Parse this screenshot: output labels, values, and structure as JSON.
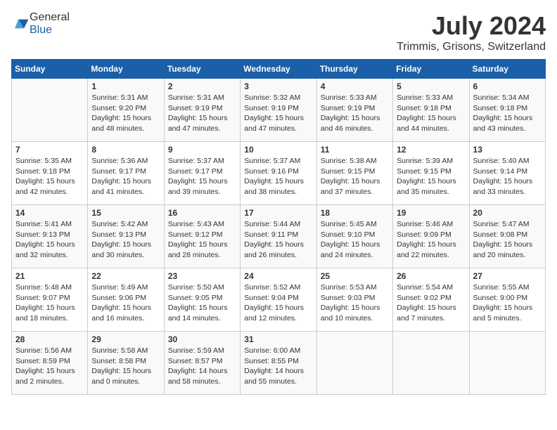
{
  "header": {
    "logo_general": "General",
    "logo_blue": "Blue",
    "month": "July 2024",
    "location": "Trimmis, Grisons, Switzerland"
  },
  "columns": [
    "Sunday",
    "Monday",
    "Tuesday",
    "Wednesday",
    "Thursday",
    "Friday",
    "Saturday"
  ],
  "weeks": [
    [
      {
        "day": "",
        "content": ""
      },
      {
        "day": "1",
        "content": "Sunrise: 5:31 AM\nSunset: 9:20 PM\nDaylight: 15 hours\nand 48 minutes."
      },
      {
        "day": "2",
        "content": "Sunrise: 5:31 AM\nSunset: 9:19 PM\nDaylight: 15 hours\nand 47 minutes."
      },
      {
        "day": "3",
        "content": "Sunrise: 5:32 AM\nSunset: 9:19 PM\nDaylight: 15 hours\nand 47 minutes."
      },
      {
        "day": "4",
        "content": "Sunrise: 5:33 AM\nSunset: 9:19 PM\nDaylight: 15 hours\nand 46 minutes."
      },
      {
        "day": "5",
        "content": "Sunrise: 5:33 AM\nSunset: 9:18 PM\nDaylight: 15 hours\nand 44 minutes."
      },
      {
        "day": "6",
        "content": "Sunrise: 5:34 AM\nSunset: 9:18 PM\nDaylight: 15 hours\nand 43 minutes."
      }
    ],
    [
      {
        "day": "7",
        "content": "Sunrise: 5:35 AM\nSunset: 9:18 PM\nDaylight: 15 hours\nand 42 minutes."
      },
      {
        "day": "8",
        "content": "Sunrise: 5:36 AM\nSunset: 9:17 PM\nDaylight: 15 hours\nand 41 minutes."
      },
      {
        "day": "9",
        "content": "Sunrise: 5:37 AM\nSunset: 9:17 PM\nDaylight: 15 hours\nand 39 minutes."
      },
      {
        "day": "10",
        "content": "Sunrise: 5:37 AM\nSunset: 9:16 PM\nDaylight: 15 hours\nand 38 minutes."
      },
      {
        "day": "11",
        "content": "Sunrise: 5:38 AM\nSunset: 9:15 PM\nDaylight: 15 hours\nand 37 minutes."
      },
      {
        "day": "12",
        "content": "Sunrise: 5:39 AM\nSunset: 9:15 PM\nDaylight: 15 hours\nand 35 minutes."
      },
      {
        "day": "13",
        "content": "Sunrise: 5:40 AM\nSunset: 9:14 PM\nDaylight: 15 hours\nand 33 minutes."
      }
    ],
    [
      {
        "day": "14",
        "content": "Sunrise: 5:41 AM\nSunset: 9:13 PM\nDaylight: 15 hours\nand 32 minutes."
      },
      {
        "day": "15",
        "content": "Sunrise: 5:42 AM\nSunset: 9:13 PM\nDaylight: 15 hours\nand 30 minutes."
      },
      {
        "day": "16",
        "content": "Sunrise: 5:43 AM\nSunset: 9:12 PM\nDaylight: 15 hours\nand 28 minutes."
      },
      {
        "day": "17",
        "content": "Sunrise: 5:44 AM\nSunset: 9:11 PM\nDaylight: 15 hours\nand 26 minutes."
      },
      {
        "day": "18",
        "content": "Sunrise: 5:45 AM\nSunset: 9:10 PM\nDaylight: 15 hours\nand 24 minutes."
      },
      {
        "day": "19",
        "content": "Sunrise: 5:46 AM\nSunset: 9:09 PM\nDaylight: 15 hours\nand 22 minutes."
      },
      {
        "day": "20",
        "content": "Sunrise: 5:47 AM\nSunset: 9:08 PM\nDaylight: 15 hours\nand 20 minutes."
      }
    ],
    [
      {
        "day": "21",
        "content": "Sunrise: 5:48 AM\nSunset: 9:07 PM\nDaylight: 15 hours\nand 18 minutes."
      },
      {
        "day": "22",
        "content": "Sunrise: 5:49 AM\nSunset: 9:06 PM\nDaylight: 15 hours\nand 16 minutes."
      },
      {
        "day": "23",
        "content": "Sunrise: 5:50 AM\nSunset: 9:05 PM\nDaylight: 15 hours\nand 14 minutes."
      },
      {
        "day": "24",
        "content": "Sunrise: 5:52 AM\nSunset: 9:04 PM\nDaylight: 15 hours\nand 12 minutes."
      },
      {
        "day": "25",
        "content": "Sunrise: 5:53 AM\nSunset: 9:03 PM\nDaylight: 15 hours\nand 10 minutes."
      },
      {
        "day": "26",
        "content": "Sunrise: 5:54 AM\nSunset: 9:02 PM\nDaylight: 15 hours\nand 7 minutes."
      },
      {
        "day": "27",
        "content": "Sunrise: 5:55 AM\nSunset: 9:00 PM\nDaylight: 15 hours\nand 5 minutes."
      }
    ],
    [
      {
        "day": "28",
        "content": "Sunrise: 5:56 AM\nSunset: 8:59 PM\nDaylight: 15 hours\nand 2 minutes."
      },
      {
        "day": "29",
        "content": "Sunrise: 5:58 AM\nSunset: 8:58 PM\nDaylight: 15 hours\nand 0 minutes."
      },
      {
        "day": "30",
        "content": "Sunrise: 5:59 AM\nSunset: 8:57 PM\nDaylight: 14 hours\nand 58 minutes."
      },
      {
        "day": "31",
        "content": "Sunrise: 6:00 AM\nSunset: 8:55 PM\nDaylight: 14 hours\nand 55 minutes."
      },
      {
        "day": "",
        "content": ""
      },
      {
        "day": "",
        "content": ""
      },
      {
        "day": "",
        "content": ""
      }
    ]
  ]
}
